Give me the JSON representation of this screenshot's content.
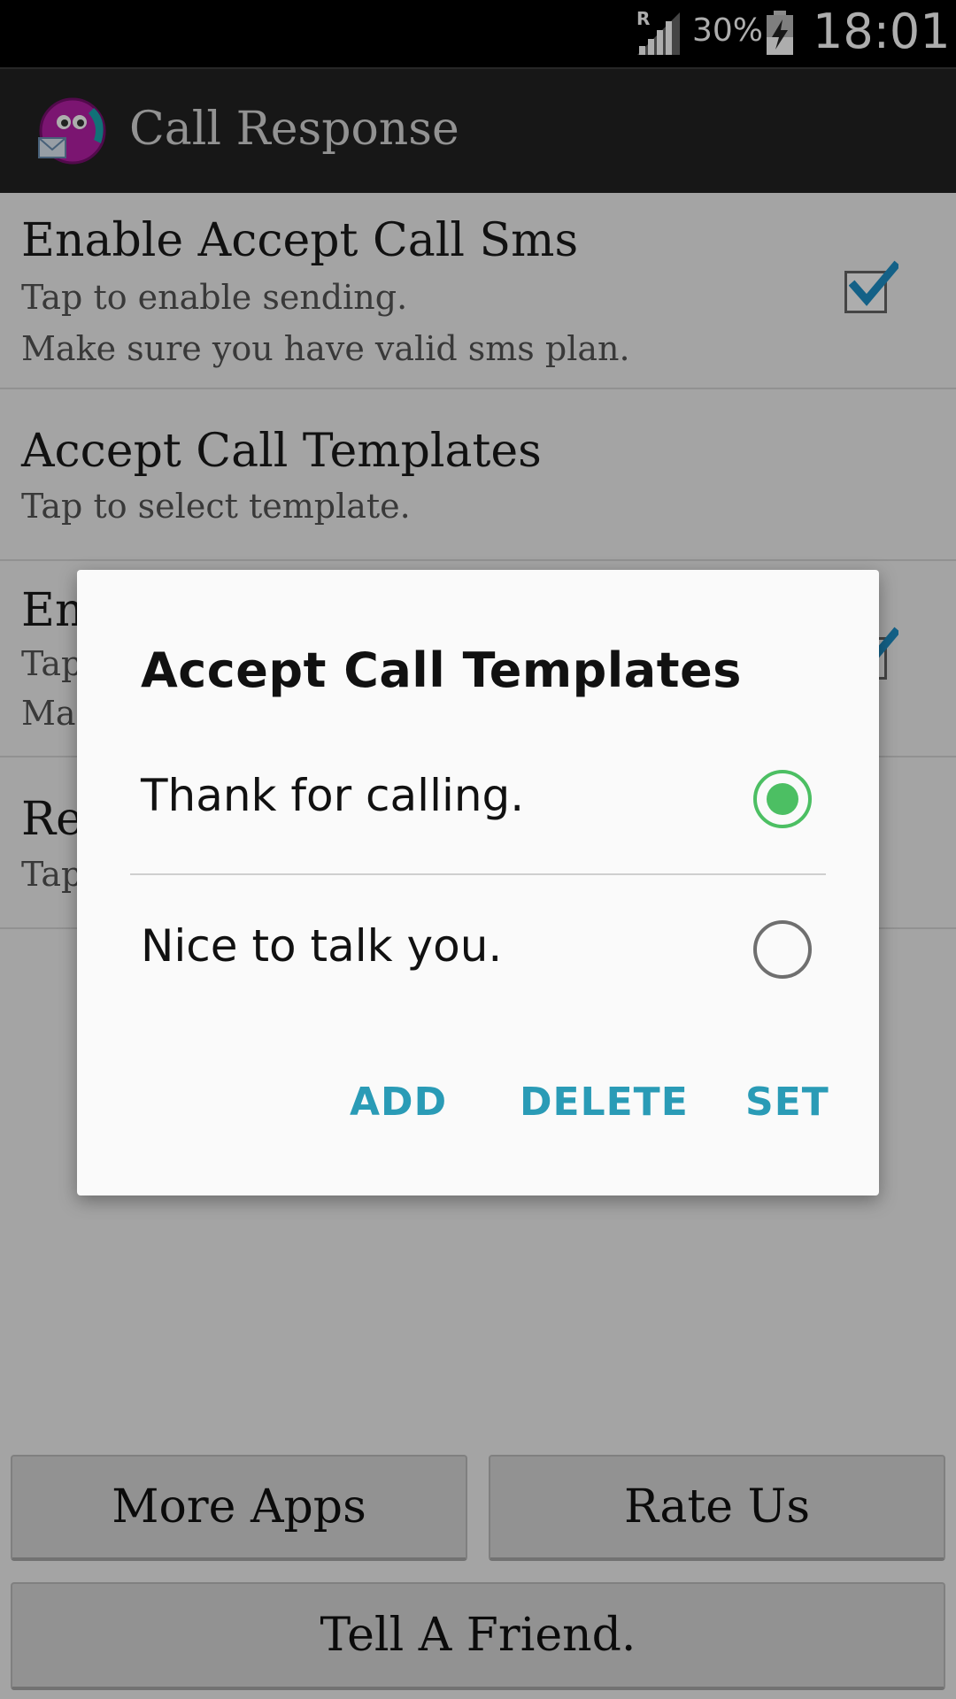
{
  "status_bar": {
    "battery_percent": "30%",
    "time": "18:01",
    "icons": [
      "signal-roaming-icon",
      "battery-charging-icon"
    ]
  },
  "app_bar": {
    "title": "Call Response",
    "icon": "app-logo-icon"
  },
  "preferences": [
    {
      "title": "Enable Accept Call Sms",
      "summary_line1": "Tap to enable sending.",
      "summary_line2": "Make sure you have valid sms plan.",
      "checked": true
    },
    {
      "title": "Accept Call Templates",
      "summary_line1": "Tap to select template."
    },
    {
      "title": "En",
      "summary_line1": "Tap",
      "summary_line2": "Ma",
      "checked": true
    },
    {
      "title": "Re",
      "summary_line1": "Tap"
    }
  ],
  "bottom_buttons": {
    "more_apps": "More Apps",
    "rate_us": "Rate Us",
    "tell_friend": "Tell A Friend."
  },
  "dialog": {
    "title": "Accept Call Templates",
    "options": [
      {
        "label": "Thank for calling.",
        "selected": true
      },
      {
        "label": "Nice to talk you.",
        "selected": false
      }
    ],
    "buttons": {
      "add": "ADD",
      "delete": "DELETE",
      "set": "SET"
    }
  },
  "colors": {
    "accent": "#2a9bb6",
    "radio_selected": "#4cbf63",
    "checkbox_check": "#1e8fc7",
    "app_bar": "#232323"
  }
}
